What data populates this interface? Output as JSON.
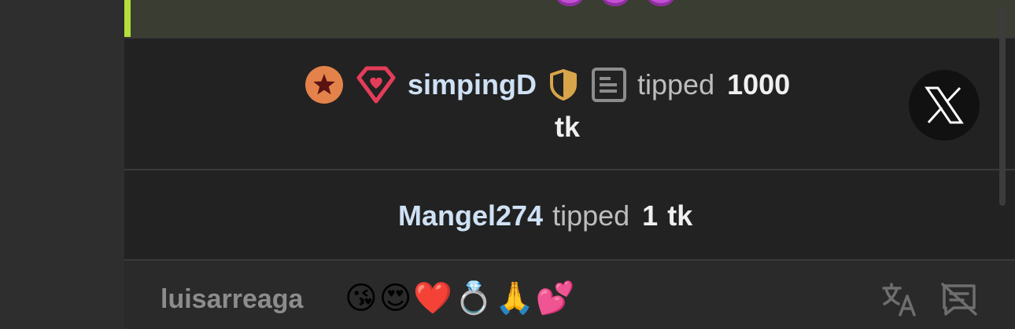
{
  "tip_events": [
    {
      "username": "simpingD",
      "verb": "tipped",
      "amount": "1000",
      "unit": "tk",
      "badges": [
        "star-badge-icon",
        "diamond-heart-icon",
        "shield-icon",
        "document-icon"
      ]
    },
    {
      "username": "Mangel274",
      "verb": "tipped",
      "amount": "1",
      "unit": "tk"
    }
  ],
  "chat_message": {
    "username": "luisarreaga",
    "text": "😘😍❤️💍🙏💕"
  },
  "actions": {
    "close_icon": "x-logo-icon",
    "translate_icon": "translate-icon",
    "hide_chat_icon": "hide-chat-icon"
  },
  "colors": {
    "highlight_accent": "#b4e03c",
    "username": "#cfe1f5",
    "muted_text": "#bdbdbd"
  }
}
